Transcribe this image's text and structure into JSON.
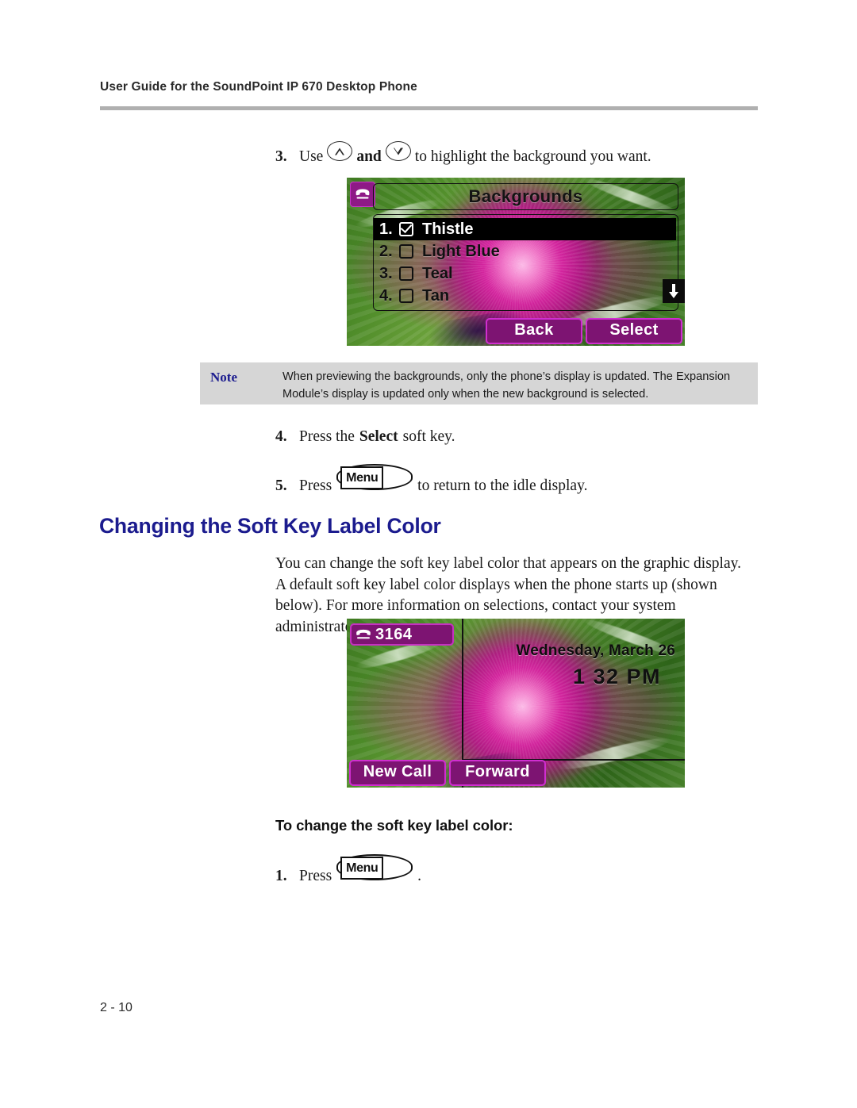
{
  "header": {
    "running_title": "User Guide for the SoundPoint IP 670 Desktop Phone"
  },
  "steps_top": {
    "step3": {
      "number": "3.",
      "text_before": "Use",
      "text_middle": "and",
      "text_after": "to highlight the background you want.",
      "up_icon": "up-arrow-key-icon",
      "down_icon": "down-arrow-key-icon"
    },
    "step4": {
      "number": "4.",
      "text_before": "Press the",
      "bold_word": "Select",
      "text_after": "soft key."
    },
    "step5": {
      "number": "5.",
      "text_before": "Press",
      "key_label": "Menu",
      "text_after": "to return to the idle display."
    }
  },
  "note": {
    "label": "Note",
    "text": "When previewing the backgrounds, only the phone’s display is updated. The Expansion Module’s display is updated only when the new background is selected."
  },
  "section": {
    "heading": "Changing the Soft Key Label Color",
    "paragraph": "You can change the soft key label color that appears on the graphic display. A default soft key label color displays when the phone starts up (shown below). For more information on selections, contact your system administrator.",
    "sub_heading": "To change the soft key label color:",
    "step1": {
      "number": "1.",
      "text_before": "Press",
      "key_label": "Menu",
      "text_after": "."
    }
  },
  "phone_menu_screen": {
    "handset_icon": "handset-icon",
    "title": "Backgrounds",
    "rows": [
      {
        "index": "1.",
        "label": "Thistle",
        "checked": true,
        "selected": true
      },
      {
        "index": "2.",
        "label": "Light Blue",
        "checked": false,
        "selected": false
      },
      {
        "index": "3.",
        "label": "Teal",
        "checked": false,
        "selected": false
      },
      {
        "index": "4.",
        "label": "Tan",
        "checked": false,
        "selected": false
      }
    ],
    "scroll_indicator": "scroll-down-icon",
    "softkeys": [
      {
        "label": "Back"
      },
      {
        "label": "Select"
      }
    ]
  },
  "phone_idle_screen": {
    "handset_icon": "handset-icon",
    "extension": "3164",
    "date": "Wednesday, March 26",
    "time": "1 32 PM",
    "softkeys": [
      {
        "label": "New Call"
      },
      {
        "label": "Forward"
      }
    ]
  },
  "footer": {
    "page_number": "2 - 10"
  },
  "colors": {
    "heading_blue": "#1b1b8e",
    "note_label_blue": "#1c1c8f",
    "note_background": "#d6d6d6",
    "softkey_fill": "#7d1472",
    "softkey_border": "#d02ed0",
    "rule_gray": "#b0b0b0"
  }
}
